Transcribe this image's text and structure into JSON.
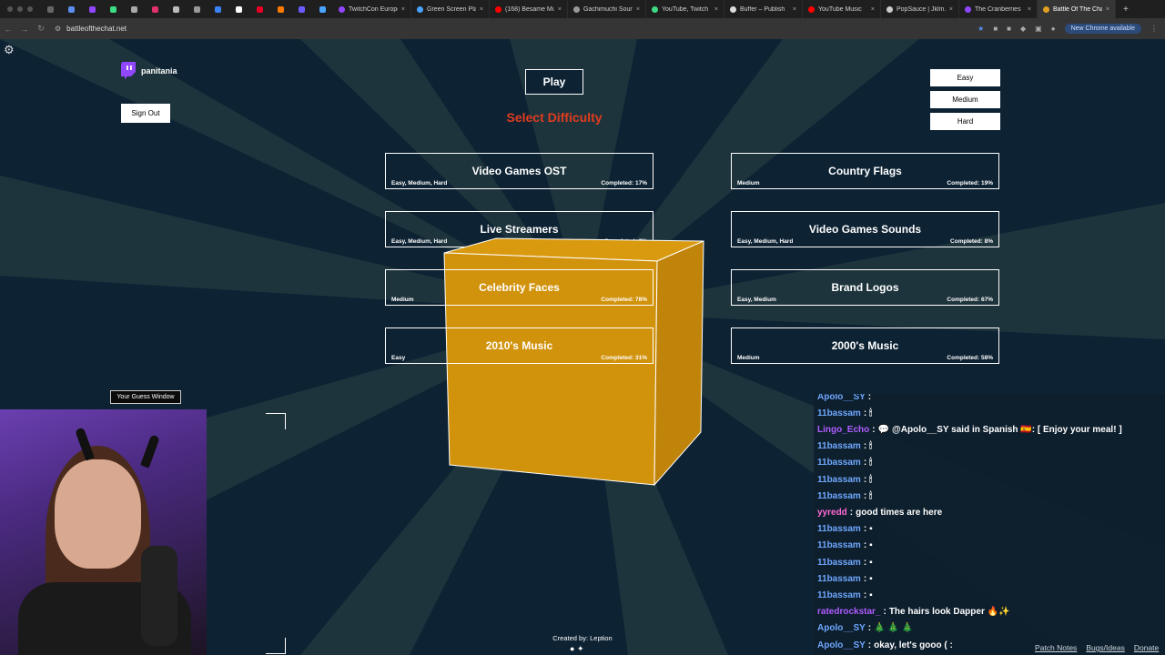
{
  "browser": {
    "tabs": [
      {
        "title": "TwitchCon Europe",
        "color": "#9146ff"
      },
      {
        "title": "Green Screen Pla",
        "color": "#4aa3ff"
      },
      {
        "title": "(168) Besame Mu",
        "color": "#ff0000"
      },
      {
        "title": "Gachimuchi Soun",
        "color": "#999999"
      },
      {
        "title": "YouTube, Twitch",
        "color": "#3ddc84"
      },
      {
        "title": "Buffer – Publish",
        "color": "#dddddd"
      },
      {
        "title": "YouTube Music",
        "color": "#ff0000"
      },
      {
        "title": "PopSauce | Jklm.f",
        "color": "#cccccc"
      },
      {
        "title": "The Cranberries",
        "color": "#9146ff"
      },
      {
        "title": "Battle Of The Cha",
        "color": "#e0a020"
      }
    ],
    "pinned_colors": [
      "#666666",
      "#5b8ef0",
      "#9146ff",
      "#3ddc84",
      "#aaaaaa",
      "#e1306c",
      "#bbbbbb",
      "#999999",
      "#3b82f6",
      "#ffffff",
      "#e60023",
      "#ff7a00",
      "#6a5cff",
      "#4aa3ff"
    ],
    "url": "battleofthechat.net",
    "update_label": "New Chrome available"
  },
  "user": {
    "name": "panitania"
  },
  "buttons": {
    "sign_out": "Sign Out",
    "guess_window": "Your Guess Window",
    "play": "Play"
  },
  "heading": "Select Difficulty",
  "difficulties": [
    "Easy",
    "Medium",
    "Hard"
  ],
  "categories": [
    {
      "title": "Video Games OST",
      "difficulties": "Easy, Medium, Hard",
      "completed": "Completed: 17%"
    },
    {
      "title": "Country Flags",
      "difficulties": "Medium",
      "completed": "Completed: 19%"
    },
    {
      "title": "Live Streamers",
      "difficulties": "Easy, Medium, Hard",
      "completed": "Completed: 6%"
    },
    {
      "title": "Video Games Sounds",
      "difficulties": "Easy, Medium, Hard",
      "completed": "Completed: 8%"
    },
    {
      "title": "Celebrity Faces",
      "difficulties": "Medium",
      "completed": "Completed: 78%"
    },
    {
      "title": "Brand Logos",
      "difficulties": "Easy, Medium",
      "completed": "Completed: 67%"
    },
    {
      "title": "2010's Music",
      "difficulties": "Easy",
      "completed": "Completed: 31%"
    },
    {
      "title": "2000's Music",
      "difficulties": "Medium",
      "completed": "Completed: 58%"
    }
  ],
  "chat": [
    {
      "user": "Apolo__SY",
      "color": "#6fa8ff",
      "msg": "",
      "emote": ""
    },
    {
      "user": "11bassam",
      "color": "#6fa8ff",
      "msg": "🕯",
      "emote": ""
    },
    {
      "user": "Lingo_Echo",
      "color": "#b05cff",
      "msg": "@Apolo__SY said in Spanish 🇪🇸: [ Enjoy your meal! ]",
      "emote": "💬"
    },
    {
      "user": "11bassam",
      "color": "#6fa8ff",
      "msg": "🕯",
      "emote": ""
    },
    {
      "user": "11bassam",
      "color": "#6fa8ff",
      "msg": "🕯",
      "emote": ""
    },
    {
      "user": "11bassam",
      "color": "#6fa8ff",
      "msg": "🕯",
      "emote": ""
    },
    {
      "user": "11bassam",
      "color": "#6fa8ff",
      "msg": "🕯",
      "emote": ""
    },
    {
      "user": "yyredd",
      "color": "#ff6ad5",
      "msg": "good times are here",
      "emote": ""
    },
    {
      "user": "11bassam",
      "color": "#6fa8ff",
      "msg": "▪",
      "emote": ""
    },
    {
      "user": "11bassam",
      "color": "#6fa8ff",
      "msg": "▪",
      "emote": ""
    },
    {
      "user": "11bassam",
      "color": "#6fa8ff",
      "msg": "▪",
      "emote": ""
    },
    {
      "user": "11bassam",
      "color": "#6fa8ff",
      "msg": "▪",
      "emote": ""
    },
    {
      "user": "11bassam",
      "color": "#6fa8ff",
      "msg": "▪",
      "emote": ""
    },
    {
      "user": "ratedrockstar_",
      "color": "#b05cff",
      "msg": "The hairs look Dapper 🔥✨",
      "emote": ""
    },
    {
      "user": "Apolo__SY",
      "color": "#6fa8ff",
      "msg": "🎄 🎄 🎄",
      "emote": ""
    },
    {
      "user": "Apolo__SY",
      "color": "#6fa8ff",
      "msg": "okay, let's gooo ( :",
      "emote": ""
    }
  ],
  "footer": {
    "credit": "Created by: Leption",
    "links": [
      "Patch Notes",
      "Bugs/Ideas",
      "Donate"
    ]
  }
}
